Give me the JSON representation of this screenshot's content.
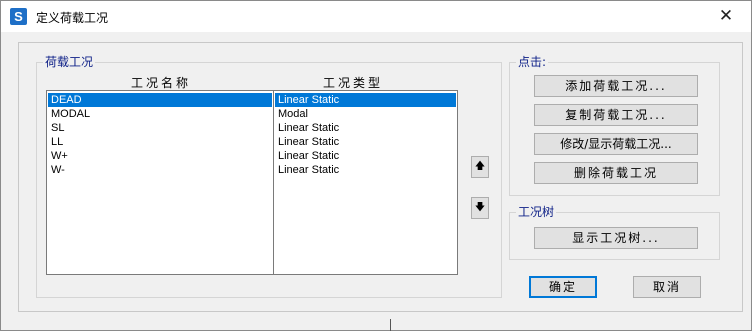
{
  "window": {
    "app_icon_letter": "S",
    "title": "定义荷载工况",
    "close_glyph": "✕"
  },
  "load_cases_group": {
    "title": "荷载工况",
    "col_name_header": "工况名称",
    "col_type_header": "工况类型",
    "rows": [
      {
        "name": "DEAD",
        "type": "Linear Static",
        "selected": true
      },
      {
        "name": "MODAL",
        "type": "Modal",
        "selected": false
      },
      {
        "name": "SL",
        "type": "Linear Static",
        "selected": false
      },
      {
        "name": "LL",
        "type": "Linear Static",
        "selected": false
      },
      {
        "name": "W+",
        "type": "Linear Static",
        "selected": false
      },
      {
        "name": "W-",
        "type": "Linear Static",
        "selected": false
      }
    ]
  },
  "move_buttons": {
    "up_glyph": "🡅",
    "down_glyph": "🡇"
  },
  "click_group": {
    "title": "点击:",
    "add_label": "添加荷载工况...",
    "copy_label": "复制荷载工况...",
    "modify_label": "修改/显示荷载工况...",
    "delete_label": "删除荷载工况"
  },
  "tree_group": {
    "title": "工况树",
    "show_tree_label": "显示工况树..."
  },
  "footer": {
    "ok_label": "确定",
    "cancel_label": "取消"
  },
  "colors": {
    "selection": "#0078d7",
    "group_title": "#0d1f87",
    "app_icon": "#1e6fc7"
  }
}
